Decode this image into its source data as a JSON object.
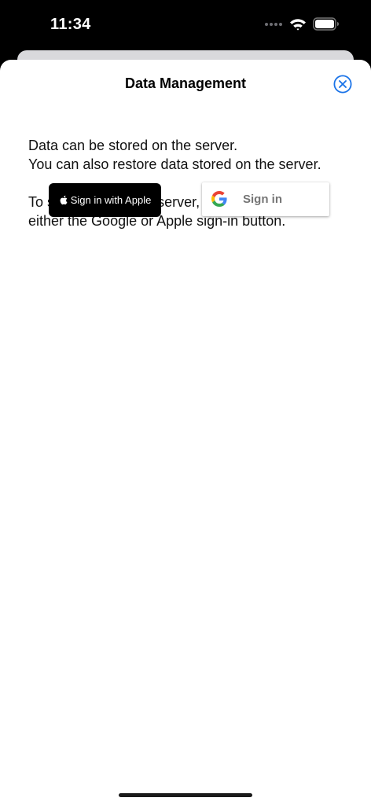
{
  "status_bar": {
    "time": "11:34",
    "icons": [
      "signal-dots-icon",
      "wifi-icon",
      "battery-icon"
    ]
  },
  "sheet": {
    "title": "Data Management",
    "close_icon": "close-circle-icon",
    "paragraphs": [
      {
        "lines": [
          "Data can be stored on the server.",
          "You can also restore data stored on the server."
        ]
      },
      {
        "lines": [
          "To store data on the server, please sign in using",
          "either the Google or Apple sign-in button."
        ]
      }
    ]
  },
  "apple_button": {
    "label": "Sign in with Apple",
    "icon": "apple-logo-icon"
  },
  "google_button": {
    "label": "Sign in",
    "icon": "google-logo-icon"
  },
  "colors": {
    "accent": "#1a73e8",
    "status_bar_background": "#000000",
    "sheet_background": "#ffffff"
  }
}
